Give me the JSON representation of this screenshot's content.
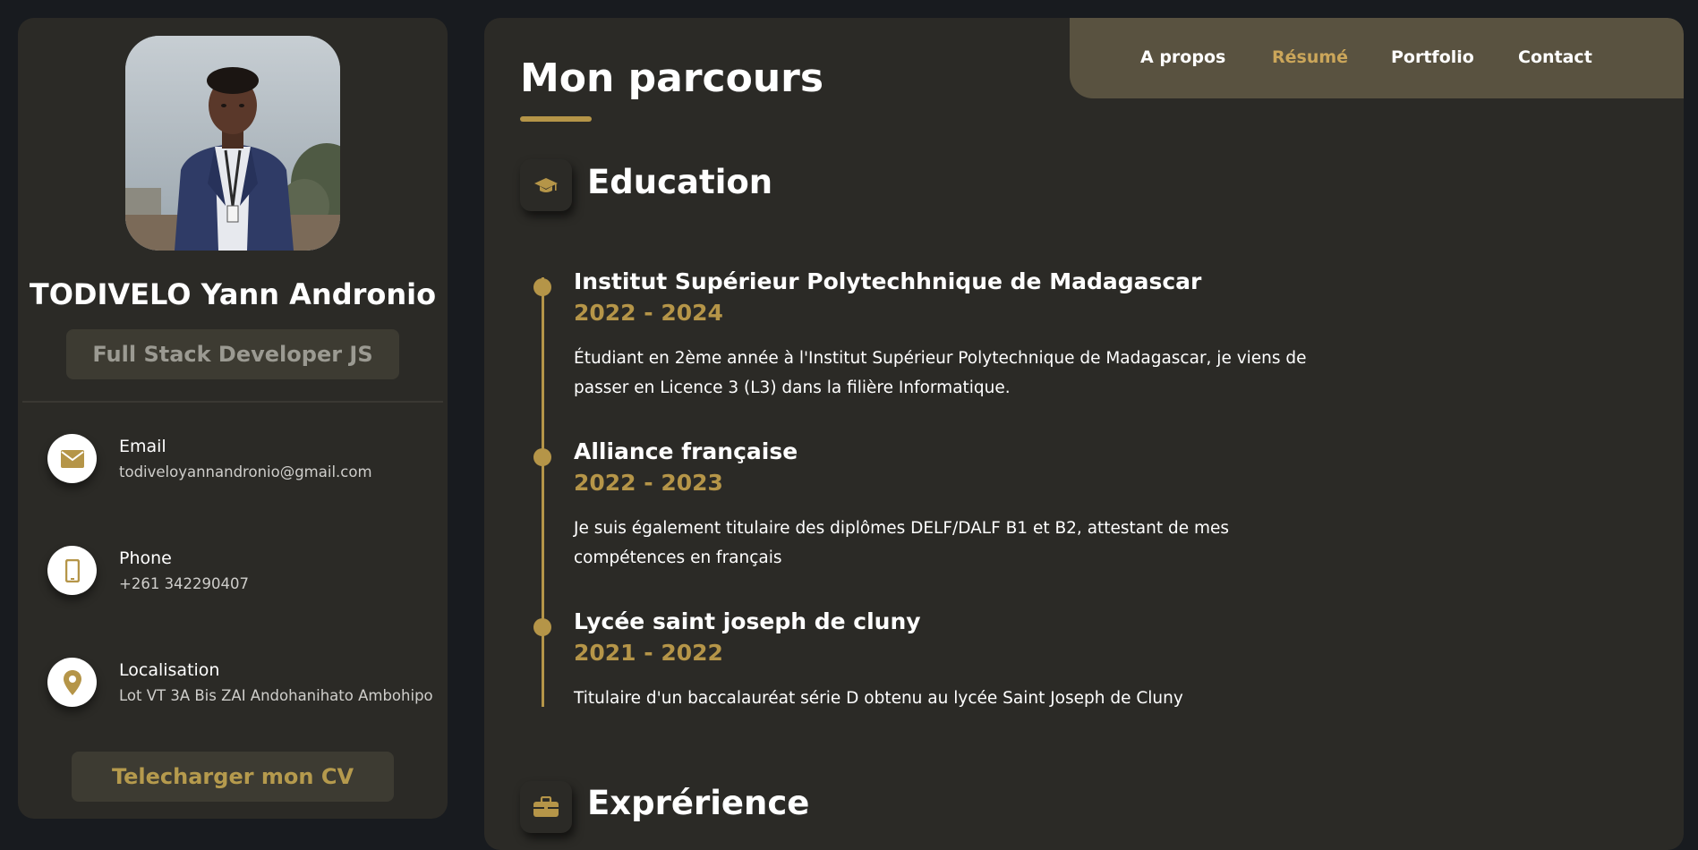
{
  "sidebar": {
    "name": "TODIVELO Yann Andronio",
    "title": "Full Stack Developer JS",
    "contacts": [
      {
        "icon": "envelope-icon",
        "label": "Email",
        "value": "todiveloyannandronio@gmail.com"
      },
      {
        "icon": "phone-icon",
        "label": "Phone",
        "value": "+261 342290407"
      },
      {
        "icon": "map-pin-icon",
        "label": "Localisation",
        "value": "Lot VT 3A Bis ZAI Andohanihato Ambohipo"
      }
    ],
    "cv_button": "Telecharger mon CV"
  },
  "nav": {
    "items": [
      {
        "label": "A propos",
        "active": false
      },
      {
        "label": "Résumé",
        "active": true
      },
      {
        "label": "Portfolio",
        "active": false
      },
      {
        "label": "Contact",
        "active": false
      }
    ]
  },
  "main": {
    "title": "Mon parcours",
    "education": {
      "icon": "graduation-cap-icon",
      "title": "Education",
      "items": [
        {
          "title": "Institut Supérieur Polytechhnique de Madagascar",
          "dates": "2022 - 2024",
          "description": "Étudiant en 2ème année à l'Institut Supérieur Polytechnique de Madagascar, je viens de passer en Licence 3 (L3) dans la filière Informatique."
        },
        {
          "title": "Alliance française",
          "dates": "2022 - 2023",
          "description": "Je suis également titulaire des diplômes DELF/DALF B1 et B2, attestant de mes compétences en français"
        },
        {
          "title": "Lycée saint joseph de cluny",
          "dates": "2021 - 2022",
          "description": "Titulaire d'un baccalauréat série D obtenu au lycée Saint Joseph de Cluny"
        }
      ]
    },
    "experience": {
      "icon": "briefcase-icon",
      "title": "Exprérience"
    }
  },
  "colors": {
    "accent": "#b59548",
    "panel": "#2b2a26",
    "navbar": "#595240",
    "background": "#181b1f"
  }
}
